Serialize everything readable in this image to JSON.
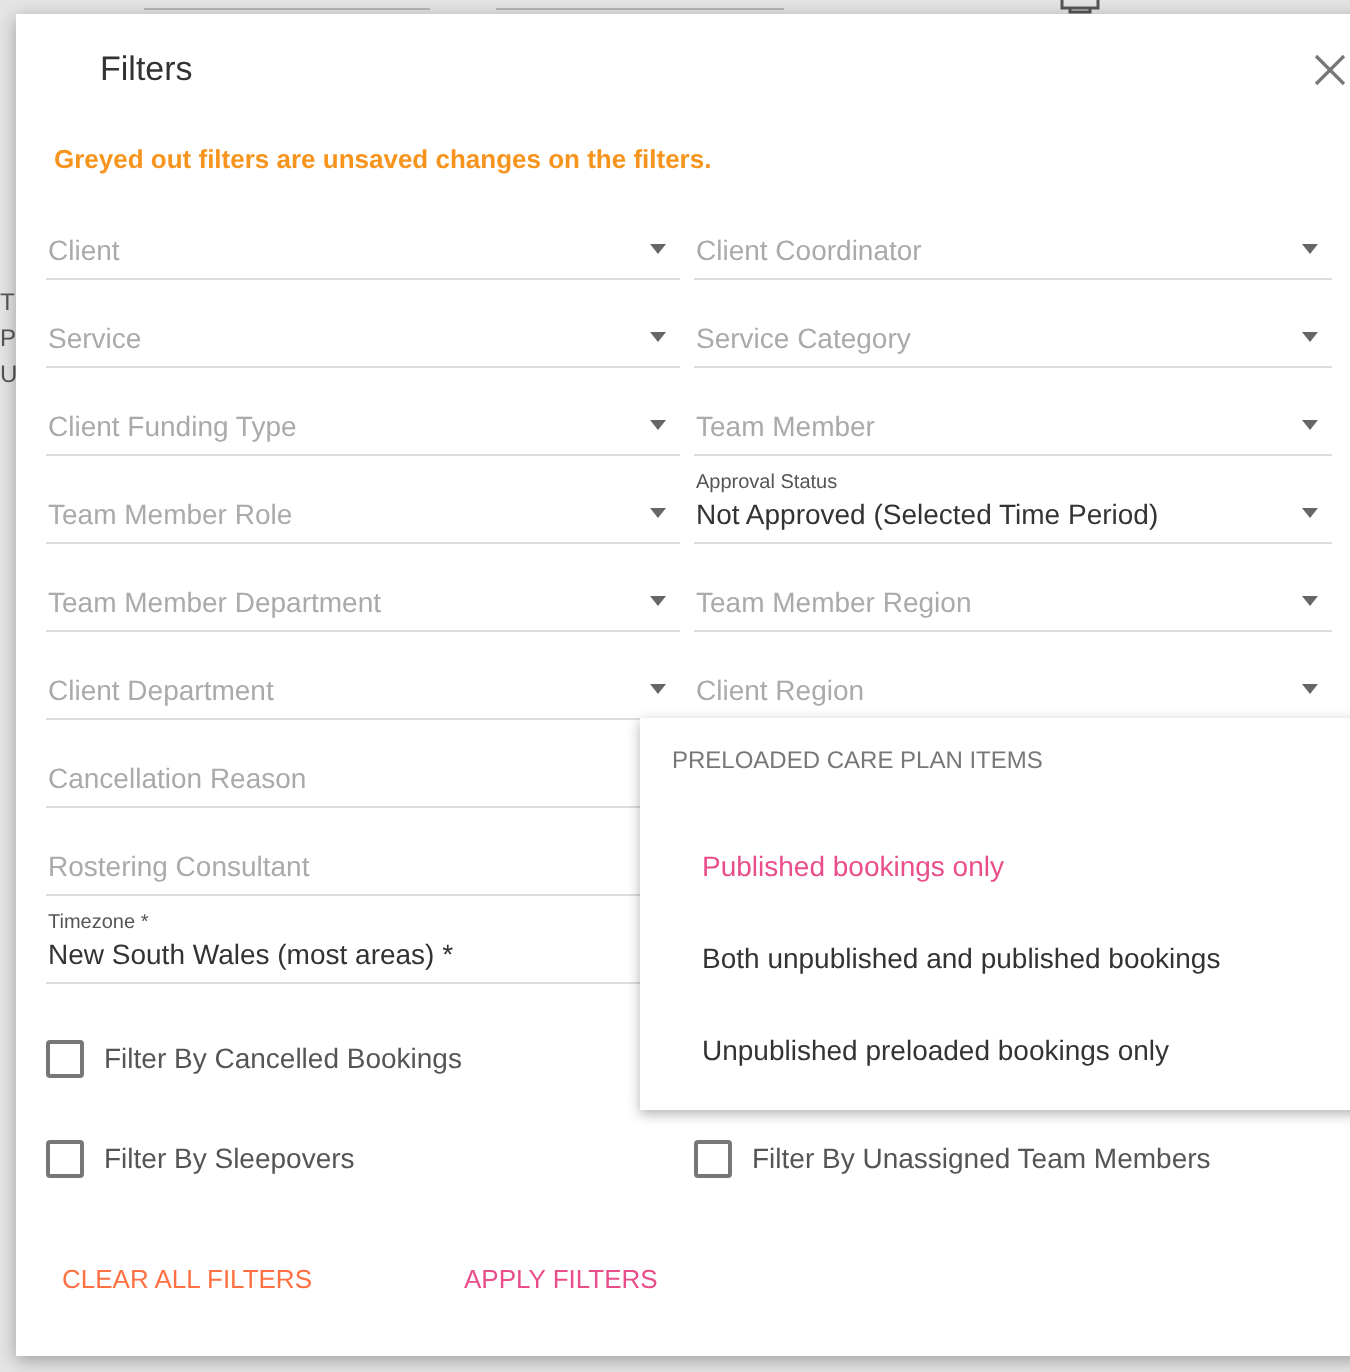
{
  "background": {
    "letters": [
      "T",
      "P",
      "U"
    ]
  },
  "dialog": {
    "title": "Filters",
    "notice": "Greyed out filters are unsaved changes on the filters.",
    "left_fields": [
      {
        "kind": "select",
        "placeholder": "Client"
      },
      {
        "kind": "select",
        "placeholder": "Service"
      },
      {
        "kind": "select",
        "placeholder": "Client Funding Type"
      },
      {
        "kind": "select",
        "placeholder": "Team Member Role"
      },
      {
        "kind": "select",
        "placeholder": "Team Member Department"
      },
      {
        "kind": "select",
        "placeholder": "Client Department"
      },
      {
        "kind": "text",
        "placeholder": "Cancellation Reason"
      },
      {
        "kind": "text",
        "placeholder": "Rostering Consultant"
      },
      {
        "kind": "select",
        "label": "Timezone *",
        "value": "New South Wales (most areas) *"
      }
    ],
    "right_fields": [
      {
        "kind": "select",
        "placeholder": "Client Coordinator"
      },
      {
        "kind": "select",
        "placeholder": "Service Category"
      },
      {
        "kind": "select",
        "placeholder": "Team Member"
      },
      {
        "kind": "select",
        "label": "Approval Status",
        "value": "Not Approved (Selected Time Period)"
      },
      {
        "kind": "select",
        "placeholder": "Team Member Region"
      },
      {
        "kind": "select",
        "placeholder": "Client Region"
      }
    ],
    "checkbox_rows": [
      [
        {
          "label": "Filter By Cancelled Bookings",
          "checked": false
        }
      ],
      [
        {
          "label": "Filter By Sleepovers",
          "checked": false
        },
        {
          "label": "Filter By Unassigned Team Members",
          "checked": false
        }
      ]
    ],
    "buttons": [
      {
        "label": "CLEAR ALL FILTERS",
        "kind": "clear"
      },
      {
        "label": "APPLY FILTERS",
        "kind": "apply"
      }
    ],
    "dropdown_menu": {
      "header": "PRELOADED CARE PLAN ITEMS",
      "items": [
        {
          "label": "Published bookings only",
          "selected": true
        },
        {
          "label": "Both unpublished and published bookings",
          "selected": false
        },
        {
          "label": "Unpublished preloaded bookings only",
          "selected": false
        }
      ]
    }
  }
}
